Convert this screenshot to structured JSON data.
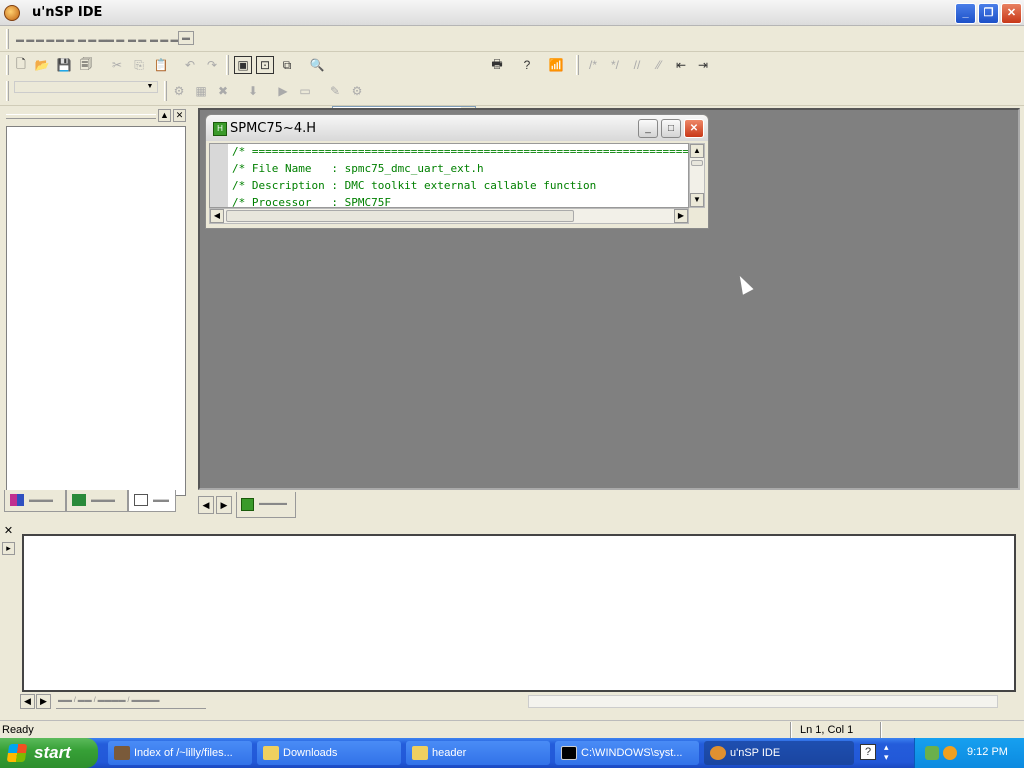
{
  "window": {
    "title": "u'nSP IDE"
  },
  "child_window": {
    "title": "SPMC75~4.H",
    "code_lines": [
      "/* =====================================================================",
      "/* File Name   : spmc75_dmc_uart_ext.h",
      "/* Description : DMC toolkit external callable function",
      "/* Processor   : SPMC75F"
    ]
  },
  "statusbar": {
    "status": "Ready",
    "position": "Ln 1, Col 1"
  },
  "taskbar": {
    "start_label": "start",
    "tasks": [
      {
        "label": "Index of /~lilly/files..."
      },
      {
        "label": "Downloads"
      },
      {
        "label": "header"
      },
      {
        "label": "C:\\WINDOWS\\syst..."
      },
      {
        "label": "u'nSP IDE"
      }
    ],
    "clock": "9:12 PM"
  },
  "colors": {
    "mdi_background": "#808080",
    "code_green": "#008000",
    "taskbar_blue": "#245ddb"
  }
}
